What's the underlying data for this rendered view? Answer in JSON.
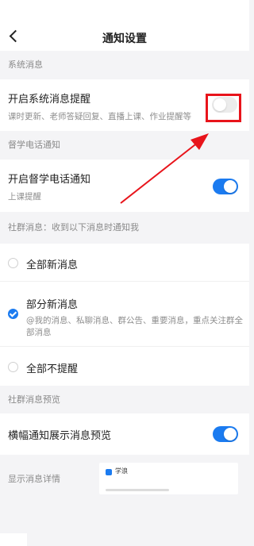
{
  "nav": {
    "title": "通知设置"
  },
  "sections": {
    "system": {
      "label": "系统消息",
      "title": "开启系统消息提醒",
      "subtitle": "课时更新、老师答疑回复、直播上课、作业提醒等",
      "enabled": false
    },
    "phone": {
      "label": "督学电话通知",
      "title": "开启督学电话通知",
      "subtitle": "上课提醒",
      "enabled": true
    },
    "community": {
      "label": "社群消息：收到以下消息时通知我",
      "options": [
        {
          "label": "全部新消息",
          "checked": false
        },
        {
          "label": "部分新消息",
          "checked": true,
          "desc": "@我的消息、私聊消息、群公告、重要消息，重点关注群全部消息"
        },
        {
          "label": "全部不提醒",
          "checked": false
        }
      ]
    },
    "preview": {
      "label": "社群消息预览",
      "title": "横幅通知展示消息预览",
      "enabled": true,
      "detail_label": "显示消息详情",
      "app_name": "学浪"
    }
  },
  "colors": {
    "accent": "#1b7bf0",
    "highlight": "#e8141b",
    "background": "#f4f4f6"
  }
}
